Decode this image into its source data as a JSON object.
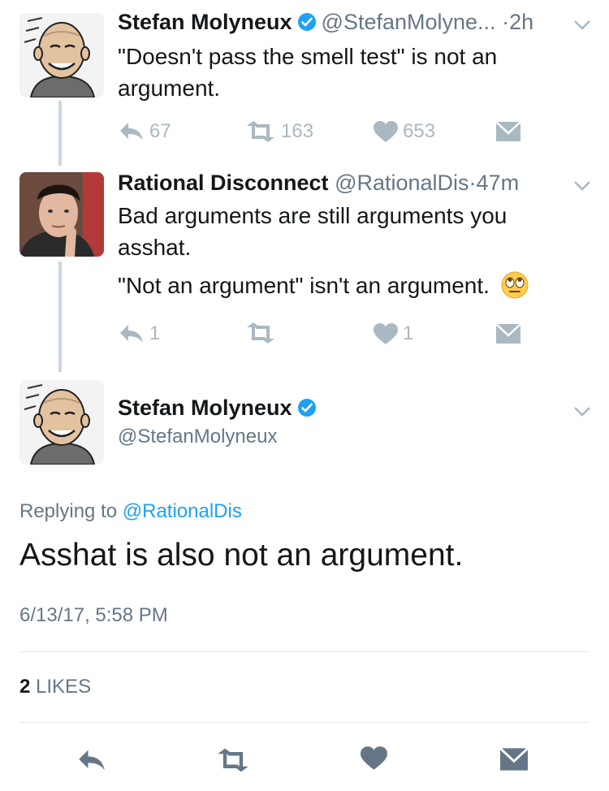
{
  "colors": {
    "link": "#1da1f2",
    "muted": "#657786",
    "icon": "#aab8c2",
    "icon_dark": "#657786",
    "verified": "#1da1f2"
  },
  "tweets": [
    {
      "name": "Stefan Molyneux",
      "handle": "@StefanMolyne...",
      "sep": "·",
      "time": "2h",
      "text_lines": [
        "\"Doesn't pass the smell test\" is not an",
        "argument."
      ],
      "replies": "67",
      "retweets": "163",
      "likes": "653"
    },
    {
      "name": "Rational Disconnect",
      "handle": "@RationalDis",
      "sep": "·",
      "time": "47m",
      "text_lines": [
        "Bad arguments are still arguments you",
        "asshat."
      ],
      "text_para2": "\"Not an argument\" isn't an argument.",
      "emoji": "face-with-rolling-eyes",
      "replies": "1",
      "retweets": "",
      "likes": "1"
    }
  ],
  "focused": {
    "name": "Stefan Molyneux",
    "handle": "@StefanMolyneux",
    "replying_prefix": "Replying to",
    "replying_to": "@RationalDis",
    "text": "Asshat is also not an argument.",
    "timestamp": "6/13/17, 5:58 PM",
    "likes_count": "2",
    "likes_label": "LIKES"
  }
}
